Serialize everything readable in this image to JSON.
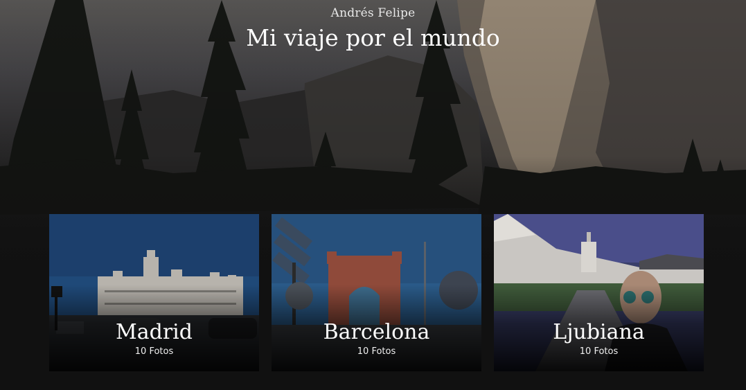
{
  "header": {
    "author": "Andrés Felipe",
    "title": "Mi viaje por el mundo"
  },
  "albums": [
    {
      "name": "Madrid",
      "count": "10 Fotos"
    },
    {
      "name": "Barcelona",
      "count": "10 Fotos"
    },
    {
      "name": "Ljubiana",
      "count": "10 Fotos"
    }
  ],
  "colors": {
    "background": "#111111",
    "text": "#ffffff"
  }
}
